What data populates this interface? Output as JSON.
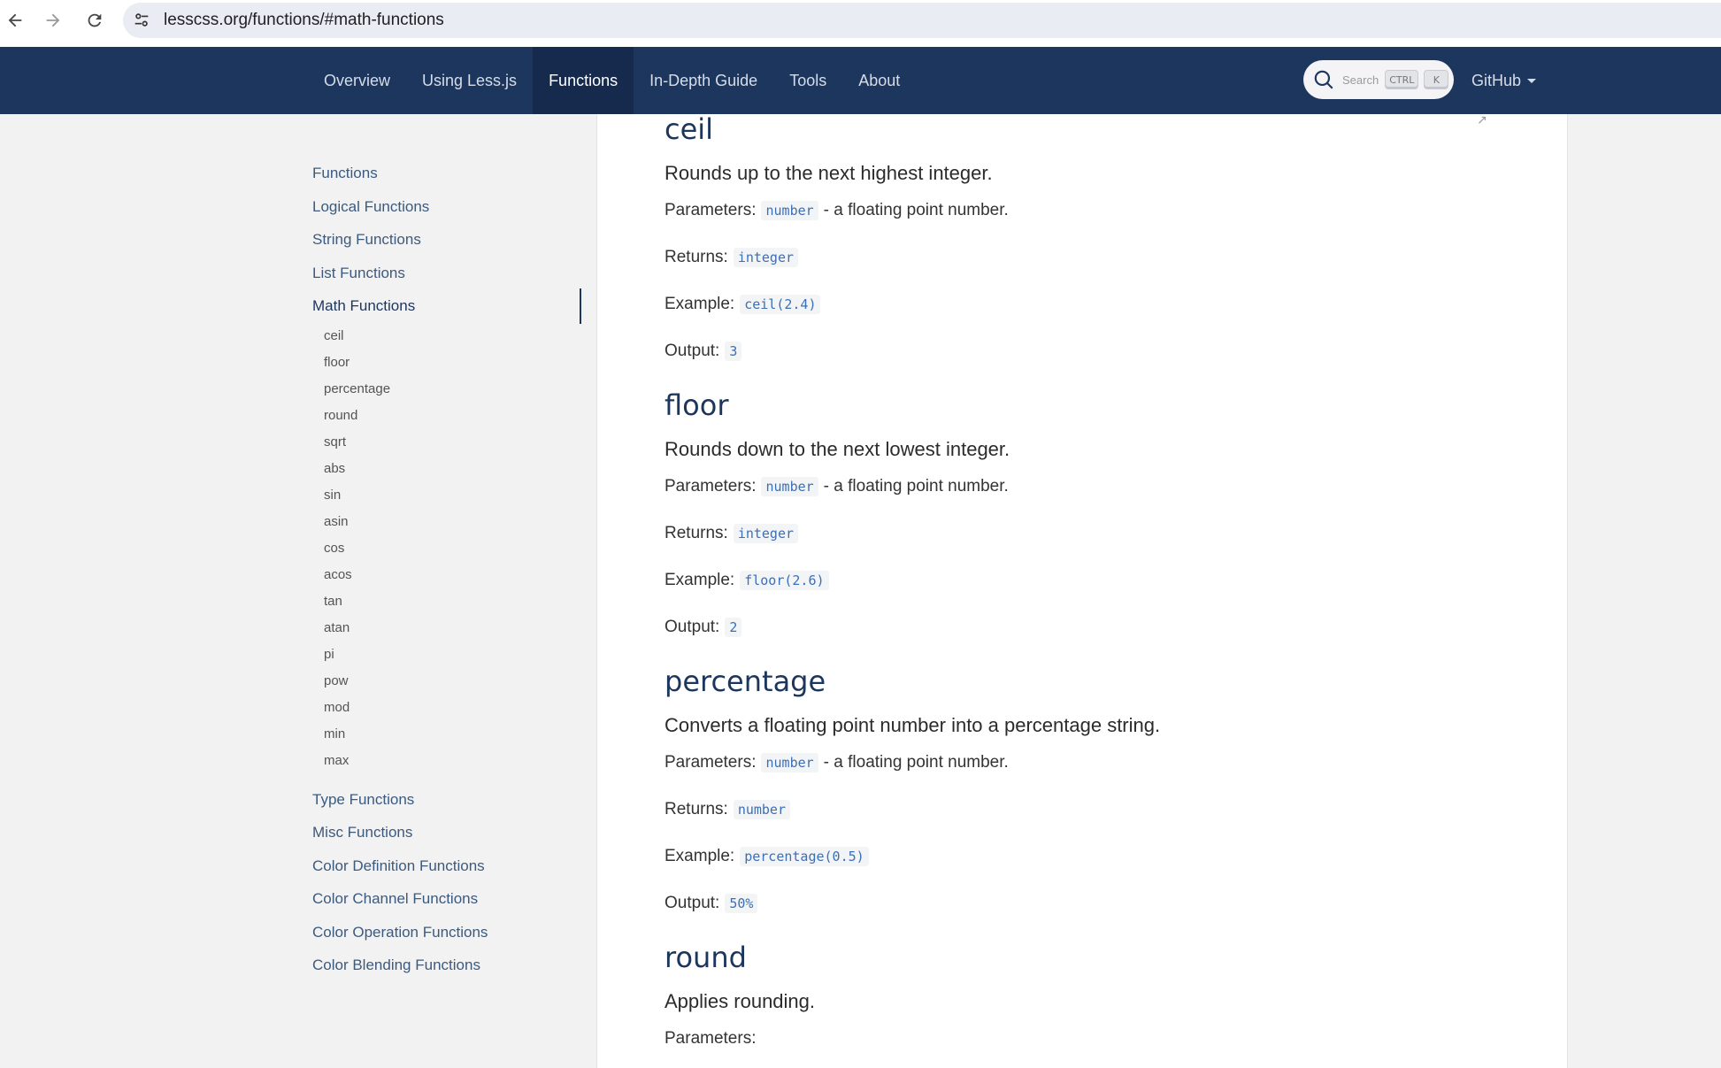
{
  "browser": {
    "url": "lesscss.org/functions/#math-functions"
  },
  "header": {
    "nav": [
      "Overview",
      "Using Less.js",
      "Functions",
      "In-Depth Guide",
      "Tools",
      "About"
    ],
    "search_placeholder": "Search",
    "search_key_1": "CTRL",
    "search_key_2": "K",
    "github_label": "GitHub"
  },
  "sidebar": {
    "top_items": [
      "Functions",
      "Logical Functions",
      "String Functions",
      "List Functions"
    ],
    "active_item": "Math Functions",
    "sub_items": [
      "ceil",
      "floor",
      "percentage",
      "round",
      "sqrt",
      "abs",
      "sin",
      "asin",
      "cos",
      "acos",
      "tan",
      "atan",
      "pi",
      "pow",
      "mod",
      "min",
      "max"
    ],
    "bottom_items": [
      "Type Functions",
      "Misc Functions",
      "Color Definition Functions",
      "Color Channel Functions",
      "Color Operation Functions",
      "Color Blending Functions"
    ]
  },
  "content": {
    "labels": {
      "parameters": "Parameters:",
      "returns": "Returns:",
      "example": "Example:",
      "output": "Output:"
    },
    "param_suffix": "- a floating point number.",
    "ceil": {
      "title": "ceil",
      "description": "Rounds up to the next highest integer.",
      "param": "number",
      "returns": "integer",
      "example": "ceil(2.4)",
      "output": "3"
    },
    "floor": {
      "title": "floor",
      "description": "Rounds down to the next lowest integer.",
      "param": "number",
      "returns": "integer",
      "example": "floor(2.6)",
      "output": "2"
    },
    "percentage": {
      "title": "percentage",
      "description": "Converts a floating point number into a percentage string.",
      "param": "number",
      "returns": "number",
      "example": "percentage(0.5)",
      "output": "50%"
    },
    "round": {
      "title": "round",
      "description": "Applies rounding."
    }
  }
}
